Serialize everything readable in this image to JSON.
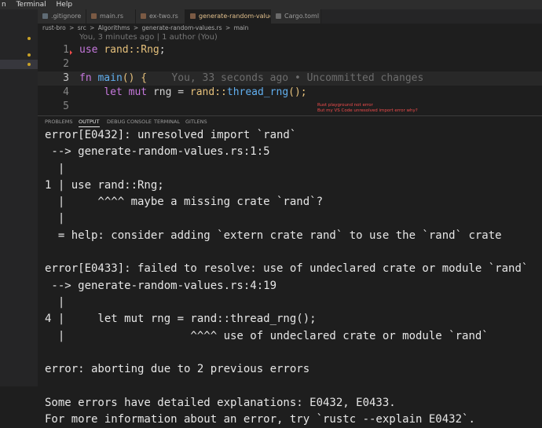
{
  "menubar": {
    "items": [
      "n",
      "Terminal",
      "Help"
    ]
  },
  "tabs": [
    {
      "label": ".gitignore",
      "icon": "gitignore-icon",
      "active": false,
      "modified": ""
    },
    {
      "label": "main.rs",
      "icon": "rust-file-icon",
      "active": false,
      "modified": ""
    },
    {
      "label": "ex-two.rs",
      "icon": "rust-file-icon",
      "active": false,
      "modified": ""
    },
    {
      "label": "generate-random-values.rs",
      "icon": "rust-file-icon",
      "active": true,
      "modified": "M"
    },
    {
      "label": "Cargo.toml",
      "icon": "toml-file-icon",
      "active": false,
      "modified": ""
    }
  ],
  "breadcrumb": [
    "rust-bro",
    ">",
    "src",
    ">",
    "Algorithms",
    ">",
    "generate-random-values.rs",
    ">",
    "main"
  ],
  "codelens": "You, 3 minutes ago | 1 author (You)",
  "code": {
    "line_numbers": [
      "1",
      "2",
      "3",
      "4",
      "5"
    ],
    "line1": {
      "kw": "use",
      "path": "rand::",
      "type": "Rng",
      "end": ";"
    },
    "line3": {
      "kw": "fn",
      "name": "main",
      "paren": "()",
      "brace": "{",
      "blame": "You, 33 seconds ago • Uncommitted changes"
    },
    "line4": {
      "kw": "let mut",
      "var": "rng",
      "eq": "=",
      "path": "rand::",
      "fn": "thread_rng",
      "end": "();"
    }
  },
  "annotation": {
    "line1": "Rust playground not error",
    "line2": "But my VS Code unresolved import error why?"
  },
  "panel_tabs": [
    "PROBLEMS",
    "OUTPUT",
    "DEBUG CONSOLE",
    "TERMINAL",
    "GITLENS"
  ],
  "output_lines": [
    "error[E0432]: unresolved import `rand`",
    " --> generate-random-values.rs:1:5",
    "  |",
    "1 | use rand::Rng;",
    "  |     ^^^^ maybe a missing crate `rand`?",
    "  |",
    "  = help: consider adding `extern crate rand` to use the `rand` crate",
    "",
    "error[E0433]: failed to resolve: use of undeclared crate or module `rand`",
    " --> generate-random-values.rs:4:19",
    "  |",
    "4 |     let mut rng = rand::thread_rng();",
    "  |                   ^^^^ use of undeclared crate or module `rand`",
    "",
    "error: aborting due to 2 previous errors",
    "",
    "Some errors have detailed explanations: E0432, E0433.",
    "For more information about an error, try `rustc --explain E0432`."
  ],
  "colors": {
    "accent": "#e2c08d",
    "error": "#f14c4c",
    "keyword": "#c678dd",
    "type": "#e5c07b",
    "function": "#61afef"
  }
}
